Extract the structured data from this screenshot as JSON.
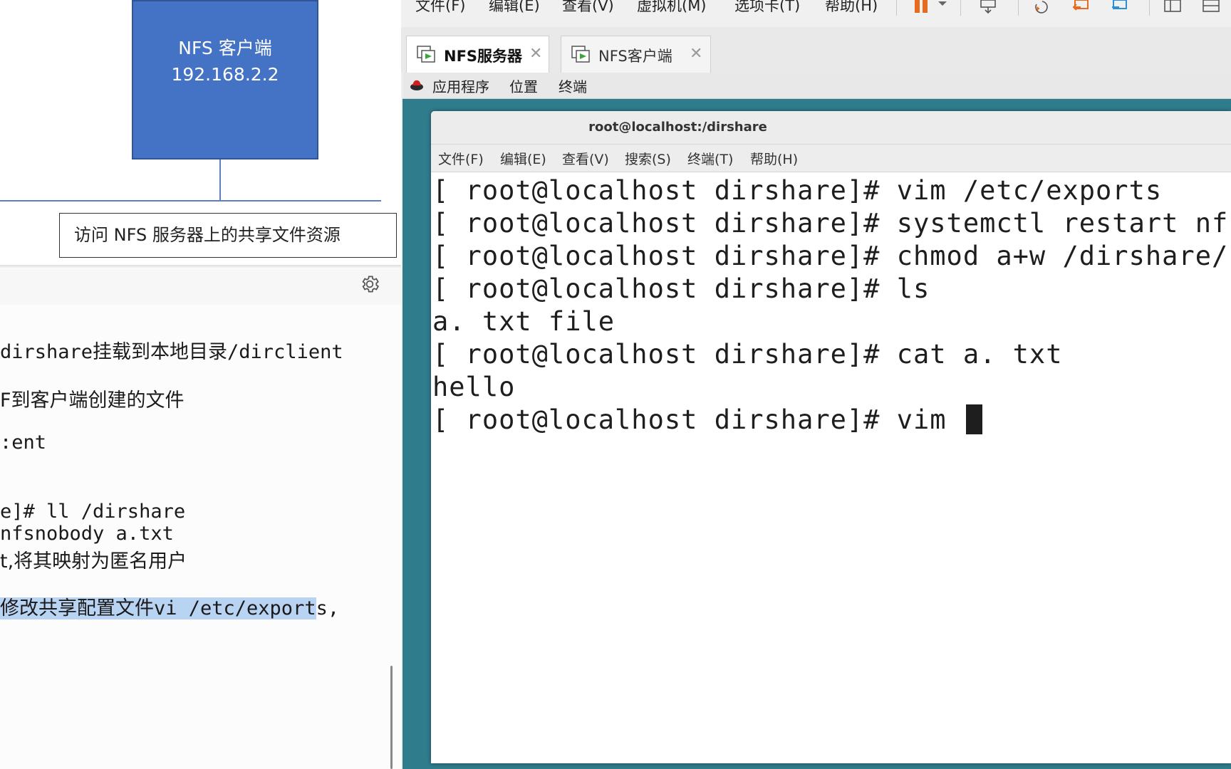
{
  "diagram": {
    "client_box_title": "NFS 客户端",
    "client_box_ip": "192.168.2.2",
    "caption": "访问 NFS 服务器上的共享文件资源"
  },
  "notes": {
    "toolbar_icon": "gear-icon",
    "lines": [
      "dirshare挂载到本地目录/dirclient",
      "F到客户端创建的文件",
      ":ent",
      "e]# ll /dirshare",
      " nfsnobody a.txt",
      "t,将其映射为匿名用户"
    ],
    "highlight_text": "修改共享配置文件vi /etc/export",
    "highlight_tail": "s,"
  },
  "vmware": {
    "menu": [
      "文件(F)",
      "编辑(E)",
      "查看(V)",
      "虚拟机(M)",
      "选项卡(T)",
      "帮助(H)"
    ],
    "toolbar_icons": [
      "pause-icon",
      "dropdown-icon",
      "send-keys-icon",
      "snapshot-icon",
      "revert-snapshot-icon",
      "manage-snapshots-icon",
      "split-view-icon",
      "fullscreen-icon"
    ],
    "accent_color": "#e86a1c",
    "tabs": [
      {
        "label": "NFS服务器",
        "active": true
      },
      {
        "label": "NFS客户端",
        "active": false
      }
    ]
  },
  "gnome": {
    "items": [
      "应用程序",
      "位置",
      "终端"
    ]
  },
  "terminal": {
    "title": "root@localhost:/dirshare",
    "menu": [
      "文件(F)",
      "编辑(E)",
      "查看(V)",
      "搜索(S)",
      "终端(T)",
      "帮助(H)"
    ],
    "lines": [
      "[ root@localhost dirshare]# vim /etc/exports",
      "[ root@localhost dirshare]# systemctl restart nfs",
      "[ root@localhost dirshare]# chmod a+w /dirshare/",
      "[ root@localhost dirshare]# ls",
      "a. txt  file",
      "[ root@localhost dirshare]# cat a. txt",
      "hello",
      "[ root@localhost dirshare]# vim "
    ]
  }
}
